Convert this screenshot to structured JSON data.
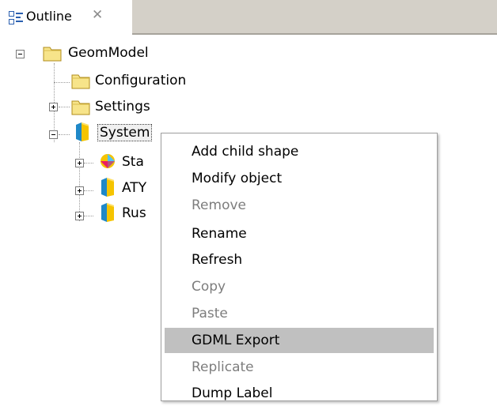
{
  "view_tab": {
    "title": "Outline",
    "icon": "outline-view-icon",
    "close_symbol": "✕"
  },
  "tree": {
    "root": {
      "label": "GeomModel",
      "icon": "folder-icon",
      "expanded": true
    },
    "children": [
      {
        "label": "Configuration",
        "icon": "folder-icon",
        "expander": "none"
      },
      {
        "label": "Settings",
        "icon": "folder-icon",
        "expander": "plus"
      },
      {
        "label": "System",
        "icon": "volume-shape-icon",
        "expander": "minus",
        "selected": true,
        "children": [
          {
            "label": "Sta",
            "icon": "assembly-shape-icon",
            "expander": "plus"
          },
          {
            "label": "ATY",
            "icon": "volume-shape-icon",
            "expander": "plus"
          },
          {
            "label": "Rus",
            "icon": "volume-shape-icon",
            "expander": "plus"
          }
        ]
      }
    ]
  },
  "context_menu": {
    "items": [
      {
        "label": "Add child shape",
        "enabled": true
      },
      {
        "label": "Modify object",
        "enabled": true
      },
      {
        "label": "Remove",
        "enabled": false
      },
      {
        "label": "Rename",
        "enabled": true
      },
      {
        "label": "Refresh",
        "enabled": true
      },
      {
        "label": "Copy",
        "enabled": false
      },
      {
        "label": "Paste",
        "enabled": false
      },
      {
        "label": "GDML Export",
        "enabled": true,
        "highlighted": true
      },
      {
        "label": "Replicate",
        "enabled": false
      },
      {
        "label": "Dump Label",
        "enabled": true
      }
    ]
  },
  "colors": {
    "folder_fill": "#f7e48a",
    "folder_border": "#b08c1c",
    "shape_left": "#1f88c8",
    "shape_right": "#f5c400",
    "menu_highlight": "#c0c0c0",
    "disabled_text": "#7d7d7d"
  }
}
